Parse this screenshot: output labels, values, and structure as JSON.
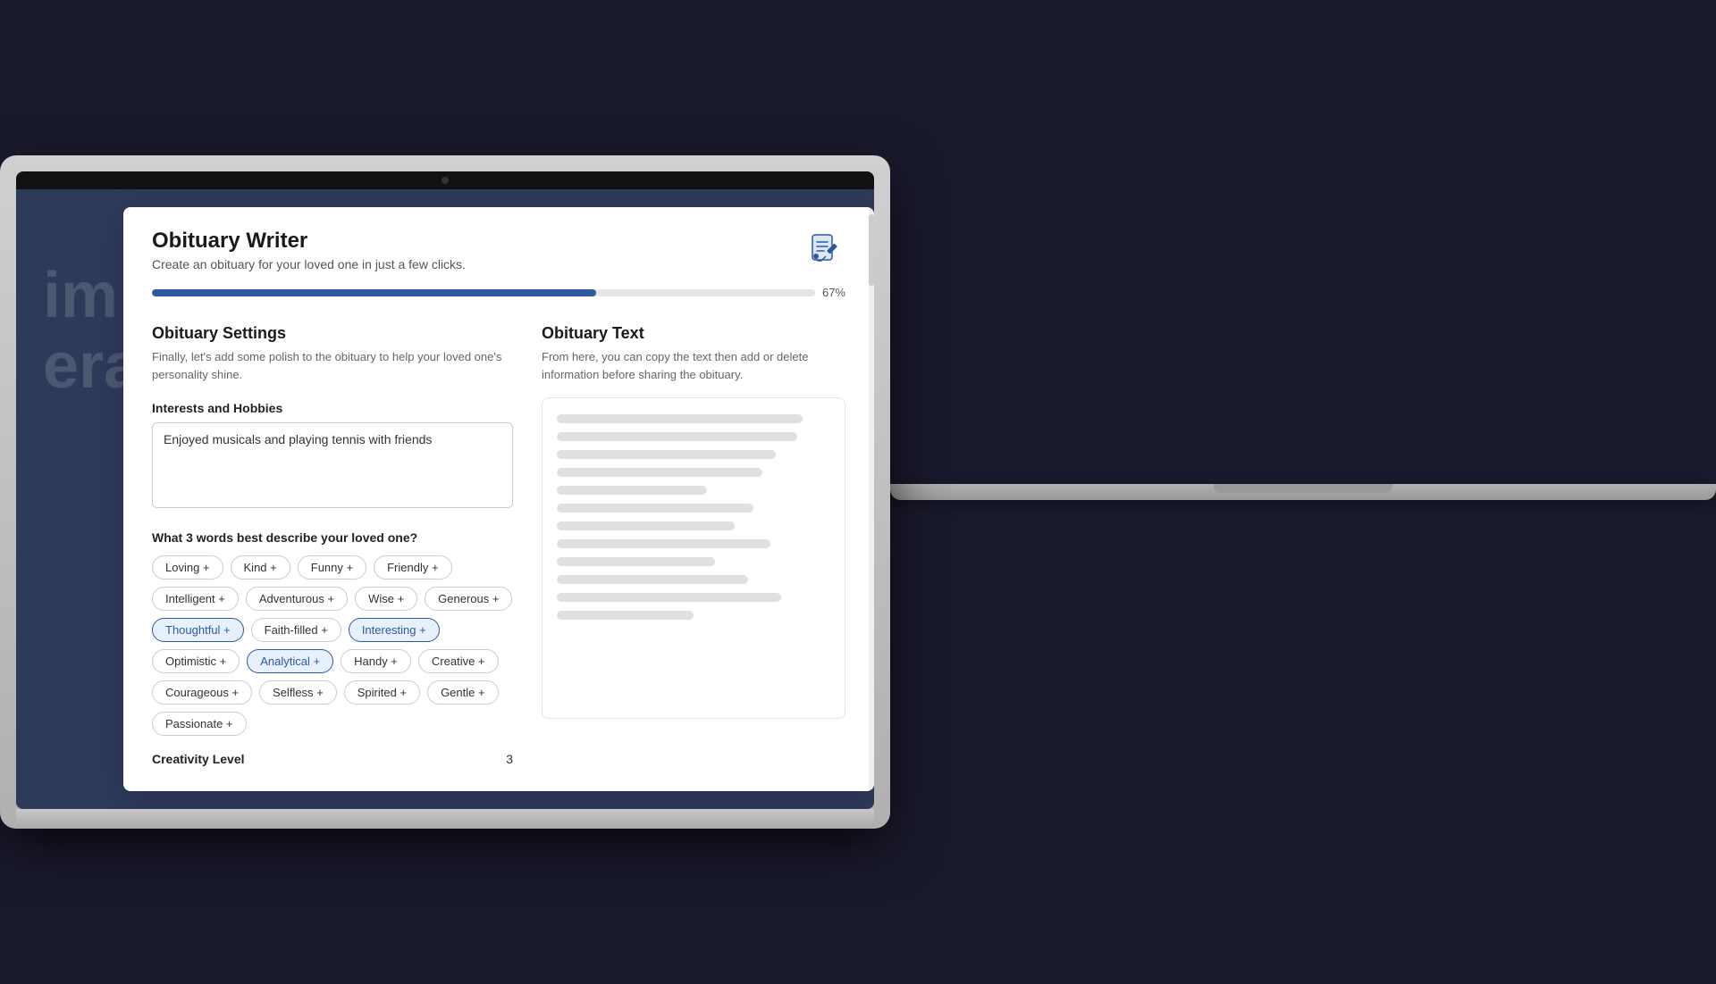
{
  "app": {
    "title": "Obituary Writer",
    "subtitle": "Create an obituary for your loved one in just a few clicks.",
    "progress_percent": 67,
    "progress_label": "67%",
    "icon_label": "document-edit-icon"
  },
  "left_panel": {
    "section_title": "Obituary Settings",
    "section_desc": "Finally, let's add some polish to the obituary to help your loved one's personality shine.",
    "interests_label": "Interests and Hobbies",
    "interests_placeholder": "Enjoyed musicals and playing tennis with friends",
    "interests_value": "Enjoyed musicals and playing tennis with friends",
    "words_question": "What 3 words best describe your loved one?",
    "tags": [
      {
        "label": "Loving +",
        "selected": false
      },
      {
        "label": "Kind +",
        "selected": false
      },
      {
        "label": "Funny +",
        "selected": false
      },
      {
        "label": "Friendly +",
        "selected": false
      },
      {
        "label": "Intelligent +",
        "selected": false
      },
      {
        "label": "Adventurous +",
        "selected": false
      },
      {
        "label": "Wise +",
        "selected": false
      },
      {
        "label": "Generous +",
        "selected": false
      },
      {
        "label": "Thoughtful +",
        "selected": true
      },
      {
        "label": "Faith-filled +",
        "selected": false
      },
      {
        "label": "Interesting +",
        "selected": true
      },
      {
        "label": "Optimistic +",
        "selected": false
      },
      {
        "label": "Analytical +",
        "selected": true
      },
      {
        "label": "Handy +",
        "selected": false
      },
      {
        "label": "Creative +",
        "selected": false
      },
      {
        "label": "Courageous +",
        "selected": false
      },
      {
        "label": "Selfless +",
        "selected": false
      },
      {
        "label": "Spirited +",
        "selected": false
      },
      {
        "label": "Gentle +",
        "selected": false
      },
      {
        "label": "Passionate +",
        "selected": false
      }
    ],
    "creativity_label": "Creativity Level",
    "creativity_value": "3"
  },
  "right_panel": {
    "section_title": "Obituary Text",
    "section_desc": "From here, you can copy the text then add or delete information before sharing the obituary.",
    "skeleton_lines": [
      {
        "width": "90%"
      },
      {
        "width": "88%"
      },
      {
        "width": "80%"
      },
      {
        "width": "75%"
      },
      {
        "width": "55%"
      },
      {
        "width": "72%"
      },
      {
        "width": "65%"
      },
      {
        "width": "78%"
      },
      {
        "width": "58%"
      },
      {
        "width": "70%"
      },
      {
        "width": "82%"
      },
      {
        "width": "50%"
      }
    ]
  },
  "bg_text": {
    "line1": "im",
    "line2": "eral"
  }
}
